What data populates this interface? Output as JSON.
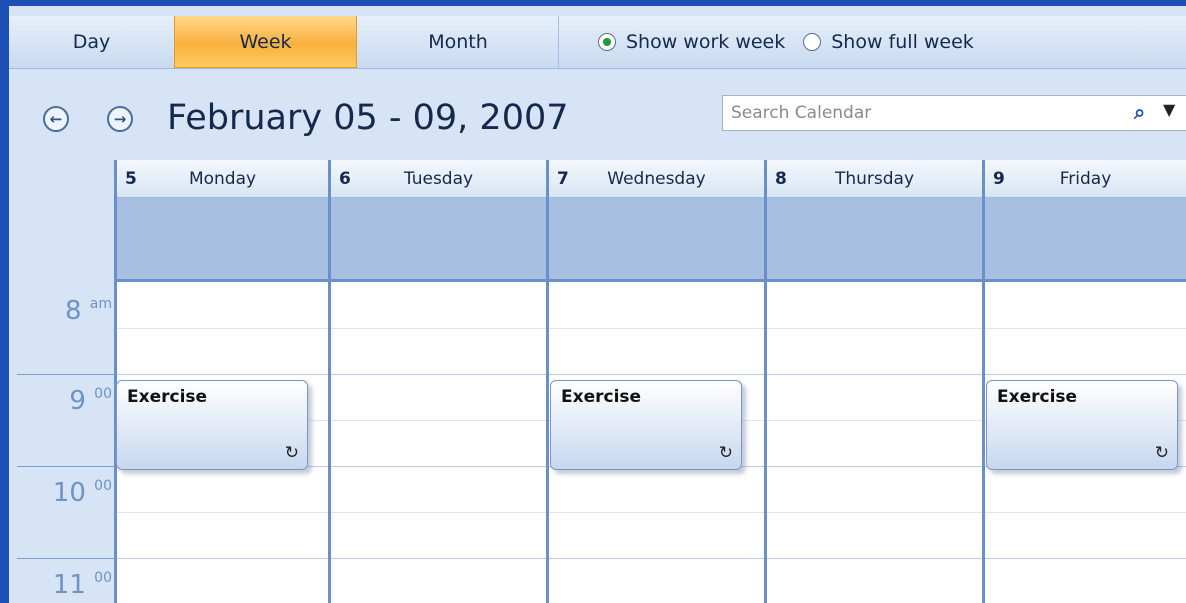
{
  "view_tabs": [
    {
      "label": "Day",
      "selected": false
    },
    {
      "label": "Week",
      "selected": true
    },
    {
      "label": "Month",
      "selected": false
    }
  ],
  "week_options": [
    {
      "label": "Show work week",
      "selected": true
    },
    {
      "label": "Show full week",
      "selected": false
    }
  ],
  "header": {
    "range_title": "February 05 - 09, 2007",
    "prev_icon": "arrow-left-icon",
    "next_icon": "arrow-right-icon"
  },
  "search": {
    "placeholder": "Search Calendar",
    "value": ""
  },
  "days": [
    {
      "num": "5",
      "name": "Monday"
    },
    {
      "num": "6",
      "name": "Tuesday"
    },
    {
      "num": "7",
      "name": "Wednesday"
    },
    {
      "num": "8",
      "name": "Thursday"
    },
    {
      "num": "9",
      "name": "Friday"
    }
  ],
  "times": [
    {
      "hour": "8",
      "suffix": "am"
    },
    {
      "hour": "9",
      "suffix": "00"
    },
    {
      "hour": "10",
      "suffix": "00"
    },
    {
      "hour": "11",
      "suffix": "00"
    }
  ],
  "appointments": [
    {
      "subject": "Exercise",
      "day": "Monday",
      "time": "9 00",
      "recurring": true
    },
    {
      "subject": "Exercise",
      "day": "Wednesday",
      "time": "9 00",
      "recurring": true
    },
    {
      "subject": "Exercise",
      "day": "Friday",
      "time": "9 00",
      "recurring": true
    }
  ],
  "colors": {
    "selected_tab": "#f9b13f",
    "background": "#d6e4f5",
    "grid_line": "#6b8fc8",
    "allday_band": "#a7bfe0"
  }
}
